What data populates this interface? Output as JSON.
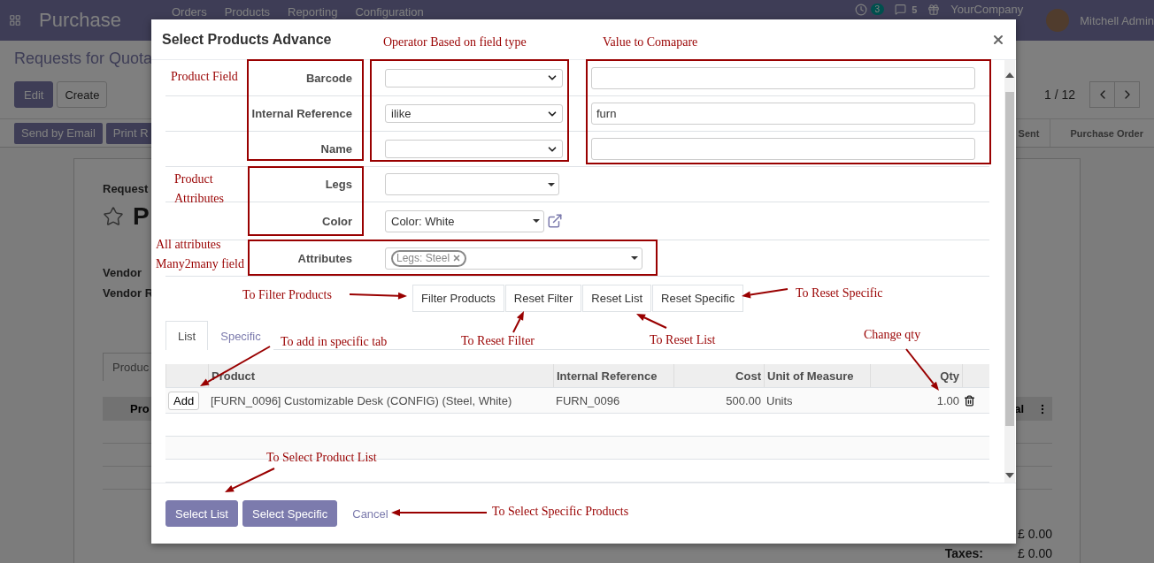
{
  "navbar": {
    "app": "Purchase",
    "menu": [
      "Orders",
      "Products",
      "Reporting",
      "Configuration"
    ],
    "activity_count": "3",
    "message_count": "5",
    "company": "YourCompany",
    "user": "Mitchell Admin"
  },
  "control_panel": {
    "breadcrumb": "Requests for Quota",
    "buttons": [
      "Edit",
      "Create"
    ],
    "pager": "1 / 12",
    "actions": [
      "Send by Email",
      "Print R"
    ],
    "statuses": [
      "Sent",
      "Purchase Order"
    ]
  },
  "form_sheet": {
    "label": "Request",
    "title": "P",
    "fields": [
      "Vendor",
      "Vendor R"
    ],
    "tab": "Produc",
    "columns": [
      "Pro",
      "al"
    ],
    "totals": [
      {
        "amount": "£ 0.00"
      },
      {
        "label": "Taxes:",
        "amount": "£ 0.00"
      }
    ]
  },
  "dialog": {
    "title": "Select Products Advance",
    "fields": [
      {
        "label": "Barcode"
      },
      {
        "label": "Internal Reference",
        "operator": "ilike",
        "value": "furn"
      },
      {
        "label": "Name"
      }
    ],
    "attributes": [
      {
        "label": "Legs"
      },
      {
        "label": "Color",
        "value": "Color: White"
      }
    ],
    "attributes_field": {
      "label": "Attributes",
      "tags": [
        "Legs: Steel"
      ]
    },
    "filter_buttons": [
      "Filter Products",
      "Reset Filter",
      "Reset List",
      "Reset Specific"
    ],
    "tabs": [
      {
        "label": "List",
        "selected": true
      },
      {
        "label": "Specific",
        "selected": false
      }
    ],
    "table": {
      "columns": [
        "Product",
        "Internal Reference",
        "Cost",
        "Unit of Measure",
        "Qty"
      ],
      "rows": [
        {
          "action": "Add",
          "product": "[FURN_0096] Customizable Desk (CONFIG) (Steel, White)",
          "internal_reference": "FURN_0096",
          "cost": "500.00",
          "uom": "Units",
          "qty": "1.00"
        }
      ]
    },
    "footer_buttons": [
      "Select List",
      "Select Specific"
    ],
    "cancel": "Cancel"
  },
  "annotations": [
    "Operator Based on field type",
    "Value to Comapare",
    "Product Field",
    "Product Attributes",
    "All attributes Many2many field",
    "To Filter Products",
    "To Reset Specific",
    "To add in specific tab",
    "To Reset Filter",
    "To Reset List",
    "Change qty",
    "To Select Product List",
    "To Select Specific Products"
  ]
}
